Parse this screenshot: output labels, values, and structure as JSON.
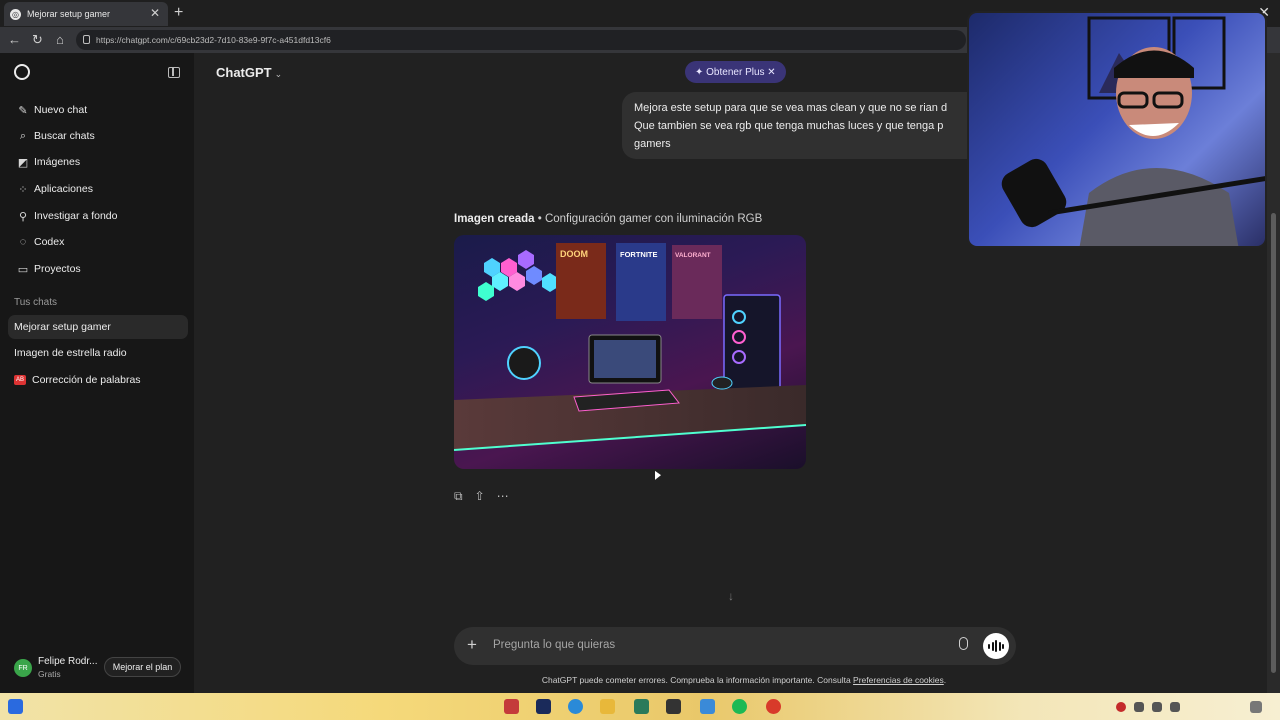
{
  "browser": {
    "tab_title": "Mejorar setup gamer",
    "url": "https://chatgpt.com/c/69cb23d2-7d10-83e9-9f7c-a451dfd13cf6"
  },
  "sidebar": {
    "items": [
      {
        "label": "Nuevo chat",
        "icon": "new-chat-icon"
      },
      {
        "label": "Buscar chats",
        "icon": "search-icon"
      },
      {
        "label": "Imágenes",
        "icon": "images-icon"
      },
      {
        "label": "Aplicaciones",
        "icon": "apps-icon"
      },
      {
        "label": "Investigar a fondo",
        "icon": "deep-research-icon"
      },
      {
        "label": "Codex",
        "icon": "codex-icon"
      },
      {
        "label": "Proyectos",
        "icon": "folder-icon"
      }
    ],
    "section_label": "Tus chats",
    "chats": [
      {
        "label": "Mejorar setup gamer"
      },
      {
        "label": "Imagen de estrella radio"
      },
      {
        "label": "Corrección de palabras",
        "badge": "AB"
      }
    ],
    "user": {
      "initials": "FR",
      "name": "Felipe Rodr...",
      "plan": "Gratis",
      "upgrade_label": "Mejorar el plan"
    }
  },
  "header": {
    "model_name": "ChatGPT",
    "plus_label": "✦ Obtener Plus ✕"
  },
  "conversation": {
    "user_message_lines": [
      "Mejora este setup para que se vea mas clean y que no se rian d",
      "Que tambien se vea rgb que tenga muchas luces y que tenga p",
      "gamers"
    ],
    "image_caption_bold": "Imagen creada",
    "image_caption_rest": " • Configuración gamer con iluminación RGB",
    "image_poster_labels": [
      "DOOM",
      "FORTNITE",
      "VALORANT"
    ]
  },
  "composer": {
    "placeholder": "Pregunta lo que quieras"
  },
  "footer": {
    "disclaimer": "ChatGPT puede cometer errores. Comprueba la información importante. Consulta ",
    "link": "Preferencias de cookies",
    "end": "."
  },
  "colors": {
    "bg": "#212121",
    "sidebar": "#171717",
    "accent_plus": "#3a3477"
  }
}
